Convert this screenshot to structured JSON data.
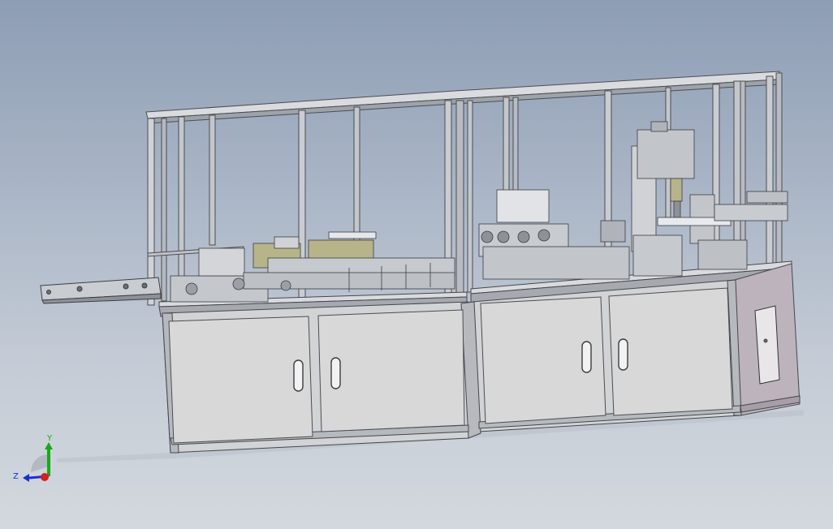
{
  "viewport": {
    "background_top": "#8d9db4",
    "background_bottom": "#d3d8de"
  },
  "model": {
    "frame_color": "#4a4d52",
    "panel_color": "#d0d0d0",
    "accent_side_panel": "#bdb3bd",
    "mechanism_yellow": "#b8b48a"
  },
  "triad": {
    "y_label": "Y",
    "z_label": "Z",
    "x_color": "#d61f1f",
    "y_color": "#18a818",
    "z_color": "#1a2fd6"
  }
}
